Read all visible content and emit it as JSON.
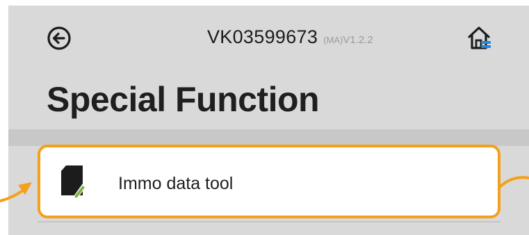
{
  "header": {
    "device_id": "VK03599673",
    "mode": "(MA)",
    "version": "V1.2.2",
    "back_icon": "back-arrow-circle-icon",
    "home_icon": "home-icon"
  },
  "page": {
    "title": "Special Function"
  },
  "menu": {
    "items": [
      {
        "label": "Immo data tool",
        "icon": "document-edit-icon"
      }
    ]
  },
  "colors": {
    "background": "#d9d9d9",
    "highlight": "#f5a01a",
    "accent_green": "#7cb342",
    "accent_blue": "#1e88e5"
  }
}
